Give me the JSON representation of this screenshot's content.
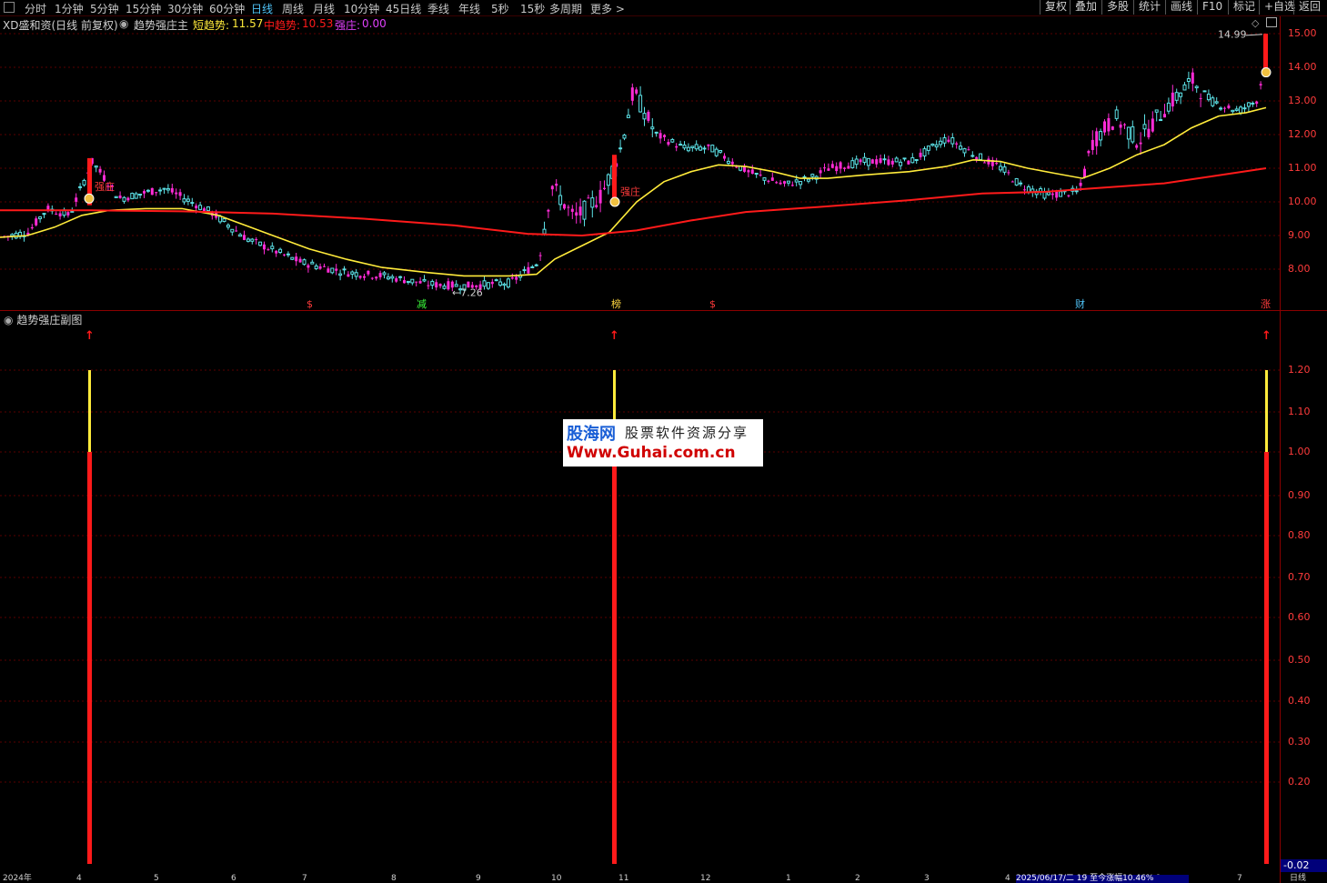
{
  "toolbar": {
    "periods": [
      "分时",
      "1分钟",
      "5分钟",
      "15分钟",
      "30分钟",
      "60分钟",
      "日线",
      "周线",
      "月线",
      "10分钟",
      "45日线",
      "季线",
      "年线",
      "5秒",
      "15秒",
      "多周期",
      "更多 >"
    ],
    "active_period": "日线",
    "right_buttons": [
      "复权",
      "叠加",
      "多股",
      "统计",
      "画线",
      "F10",
      "标记",
      "+自选",
      "返回"
    ]
  },
  "info": {
    "stock": "XD盛和资(日线 前复权)",
    "indicator": "趋势强庄主",
    "short_label": "短趋势:",
    "short_value": "11.57",
    "mid_label": "中趋势:",
    "mid_value": "10.53",
    "strong_label": "强庄:",
    "strong_value": "0.00"
  },
  "main_axis": [
    "15.00",
    "14.00",
    "13.00",
    "12.00",
    "11.00",
    "10.00",
    "9.00",
    "8.00"
  ],
  "price_labels": {
    "high": "14.99",
    "low": "7.26"
  },
  "signal_labels": [
    {
      "text": "$",
      "color": "#ff3b3b"
    },
    {
      "text": "减",
      "color": "#3cff3c"
    },
    {
      "text": "榜",
      "color": "#ffd740"
    },
    {
      "text": "$",
      "color": "#ff3b3b"
    },
    {
      "text": "财",
      "color": "#4fc3f7"
    },
    {
      "text": "涨",
      "color": "#ff3b3b"
    }
  ],
  "strong_marks": [
    "强庄",
    "强庄"
  ],
  "sub": {
    "title": "趋势强庄副图",
    "axis": [
      "1.20",
      "1.10",
      "1.00",
      "0.90",
      "0.80",
      "0.70",
      "0.60",
      "0.50",
      "0.40",
      "0.30",
      "0.20"
    ],
    "neg_value": "-0.02"
  },
  "watermark": {
    "brand": "股海网",
    "tagline": "股票软件资源分享",
    "url": "Www.Guhai.com.cn"
  },
  "bottom": {
    "year": "2024年",
    "months": [
      "4",
      "5",
      "6",
      "7",
      "8",
      "9",
      "10",
      "11",
      "12",
      "1",
      "2",
      "3",
      "4",
      "5",
      "6",
      "7"
    ],
    "status": "2025/06/17/二 19 至今涨幅10.46%",
    "period_tag": "日线"
  },
  "chart_data": {
    "type": "candlestick",
    "title": "",
    "ylim": [
      7.5,
      15.3
    ],
    "series": [
      {
        "name": "短趋势",
        "color": "#ffeb3b",
        "values": [
          8.9,
          9.0,
          9.6,
          9.8,
          9.75,
          9.8,
          9.6,
          9.1,
          8.6,
          8.3,
          8.05,
          7.9,
          7.8,
          7.8,
          7.8,
          8.6,
          9.2,
          10.0,
          10.6,
          11.0,
          11.1,
          11.0,
          10.8,
          10.7,
          10.8,
          10.9,
          11.0,
          11.2,
          11.3,
          11.0,
          10.9,
          11.0,
          11.6,
          12.0,
          12.3,
          12.7,
          12.6,
          12.7
        ]
      },
      {
        "name": "中趋势",
        "color": "#ff1a1a",
        "values": [
          9.75,
          9.75,
          9.7,
          9.65,
          9.6,
          9.5,
          9.3,
          9.1,
          9.0,
          9.0,
          9.2,
          9.5,
          9.7,
          9.85,
          9.95,
          10.0,
          10.1,
          10.15,
          10.25,
          10.4,
          10.55,
          10.7,
          10.9,
          11.0
        ]
      }
    ],
    "signals": [
      0,
      0,
      1
    ]
  }
}
